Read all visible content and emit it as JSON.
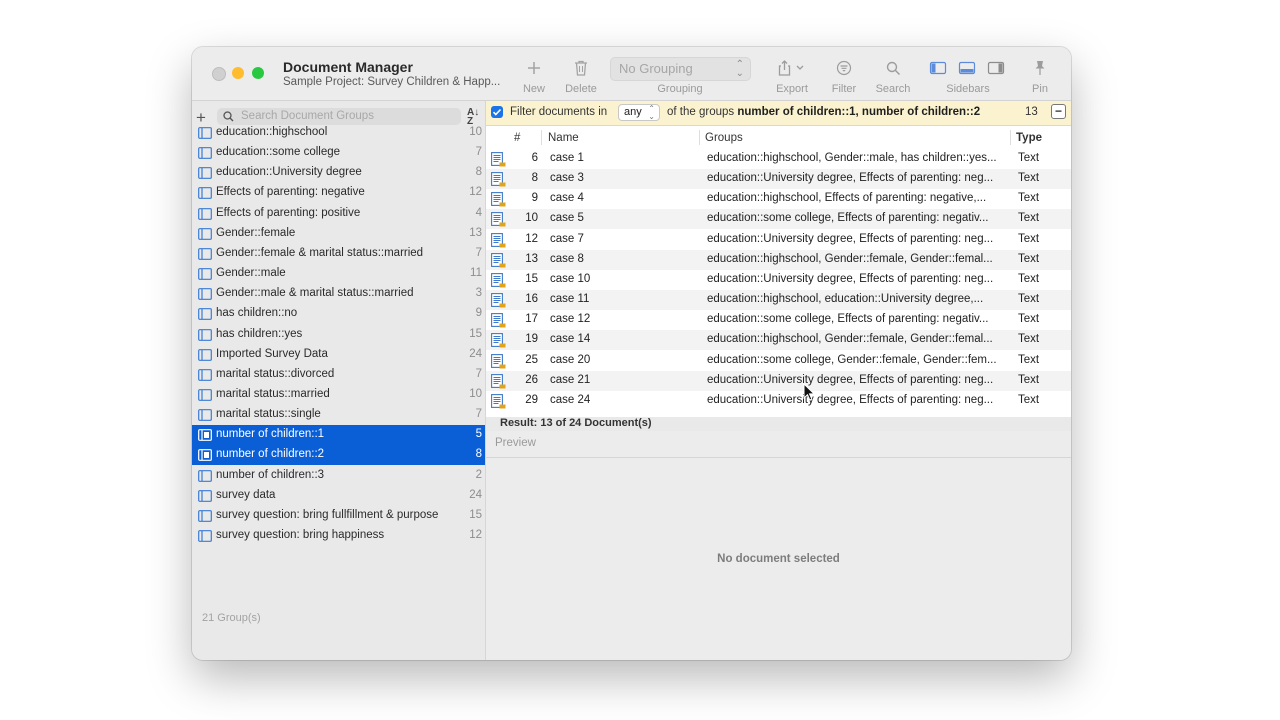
{
  "window": {
    "title": "Document Manager",
    "subtitle": "Sample Project: Survey Children & Happ..."
  },
  "toolbar": {
    "new_label": "New",
    "delete_label": "Delete",
    "grouping_value": "No Grouping",
    "grouping_label": "Grouping",
    "export_label": "Export",
    "filter_label": "Filter",
    "search_label": "Search",
    "sidebars_label": "Sidebars",
    "pin_label": "Pin"
  },
  "sidebar": {
    "search_placeholder": "Search Document Groups",
    "groups": [
      {
        "name": "education::highschool",
        "count": "10",
        "selected": false
      },
      {
        "name": "education::some college",
        "count": "7",
        "selected": false
      },
      {
        "name": "education::University degree",
        "count": "8",
        "selected": false
      },
      {
        "name": "Effects of parenting: negative",
        "count": "12",
        "selected": false
      },
      {
        "name": "Effects of parenting: positive",
        "count": "4",
        "selected": false
      },
      {
        "name": "Gender::female",
        "count": "13",
        "selected": false
      },
      {
        "name": "Gender::female & marital status::married",
        "count": "7",
        "selected": false
      },
      {
        "name": "Gender::male",
        "count": "11",
        "selected": false
      },
      {
        "name": "Gender::male & marital status::married",
        "count": "3",
        "selected": false
      },
      {
        "name": "has children::no",
        "count": "9",
        "selected": false
      },
      {
        "name": "has children::yes",
        "count": "15",
        "selected": false
      },
      {
        "name": "Imported Survey Data",
        "count": "24",
        "selected": false
      },
      {
        "name": "marital status::divorced",
        "count": "7",
        "selected": false
      },
      {
        "name": "marital status::married",
        "count": "10",
        "selected": false
      },
      {
        "name": "marital status::single",
        "count": "7",
        "selected": false
      },
      {
        "name": "number of children::1",
        "count": "5",
        "selected": true
      },
      {
        "name": "number of children::2",
        "count": "8",
        "selected": true
      },
      {
        "name": "number of children::3",
        "count": "2",
        "selected": false
      },
      {
        "name": "survey data",
        "count": "24",
        "selected": false
      },
      {
        "name": "survey question: bring fullfillment & purpose",
        "count": "15",
        "selected": false
      },
      {
        "name": "survey question: bring happiness",
        "count": "12",
        "selected": false
      }
    ],
    "footer": "21 Group(s)"
  },
  "filter": {
    "text_before": "Filter documents in",
    "mode": "any",
    "text_middle": "of the groups",
    "groups_text": "number of children::1, number of children::2",
    "count": "13",
    "remove_symbol": "−"
  },
  "table": {
    "headers": {
      "num": "#",
      "name": "Name",
      "groups": "Groups",
      "type": "Type"
    },
    "rows": [
      {
        "num": "6",
        "name": "case 1",
        "groups": "education::highschool, Gender::male, has children::yes...",
        "type": "Text"
      },
      {
        "num": "8",
        "name": "case 3",
        "groups": "education::University degree, Effects of parenting: neg...",
        "type": "Text"
      },
      {
        "num": "9",
        "name": "case 4",
        "groups": "education::highschool, Effects of parenting: negative,...",
        "type": "Text"
      },
      {
        "num": "10",
        "name": "case 5",
        "groups": "education::some college, Effects of parenting: negativ...",
        "type": "Text"
      },
      {
        "num": "12",
        "name": "case 7",
        "groups": "education::University degree, Effects of parenting: neg...",
        "type": "Text"
      },
      {
        "num": "13",
        "name": "case 8",
        "groups": "education::highschool, Gender::female, Gender::femal...",
        "type": "Text"
      },
      {
        "num": "15",
        "name": "case 10",
        "groups": "education::University degree, Effects of parenting: neg...",
        "type": "Text"
      },
      {
        "num": "16",
        "name": "case 11",
        "groups": "education::highschool, education::University degree,...",
        "type": "Text"
      },
      {
        "num": "17",
        "name": "case 12",
        "groups": "education::some college, Effects of parenting: negativ...",
        "type": "Text"
      },
      {
        "num": "19",
        "name": "case 14",
        "groups": "education::highschool, Gender::female, Gender::femal...",
        "type": "Text"
      },
      {
        "num": "25",
        "name": "case 20",
        "groups": "education::some college, Gender::female, Gender::fem...",
        "type": "Text"
      },
      {
        "num": "26",
        "name": "case 21",
        "groups": "education::University degree, Effects of parenting: neg...",
        "type": "Text"
      },
      {
        "num": "29",
        "name": "case 24",
        "groups": "education::University degree, Effects of parenting: neg...",
        "type": "Text"
      }
    ],
    "result": "Result: 13 of 24 Document(s)"
  },
  "preview": {
    "header": "Preview",
    "empty_text": "No document selected"
  },
  "colors": {
    "selection": "#0a5fd6",
    "filter_bar": "#fbf3cf",
    "checkbox": "#1a73e8"
  },
  "icons": {
    "group": "document-group-icon",
    "document": "text-document-icon"
  }
}
